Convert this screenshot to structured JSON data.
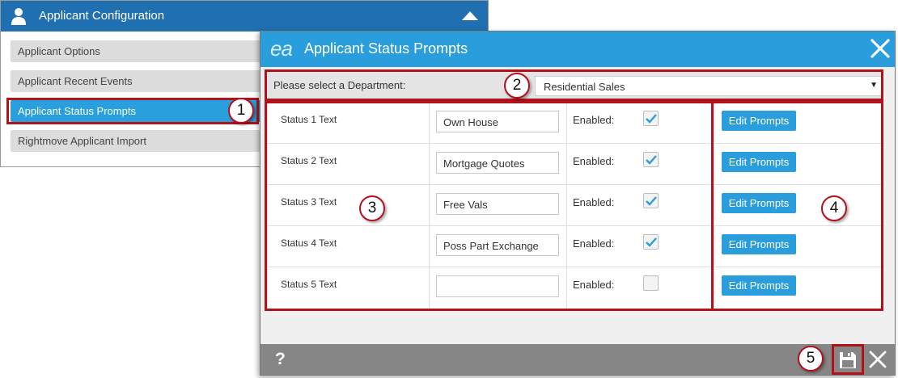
{
  "background_panel": {
    "title": "Applicant Configuration",
    "items": [
      {
        "label": "Applicant Options"
      },
      {
        "label": "Applicant Recent Events"
      },
      {
        "label": "Applicant Status Prompts"
      },
      {
        "label": "Rightmove Applicant Import"
      }
    ],
    "active_index": 2
  },
  "dialog": {
    "logo_text": "ea",
    "title": "Applicant Status Prompts",
    "department": {
      "label": "Please select a Department:",
      "selected": "Residential Sales"
    },
    "enabled_label": "Enabled:",
    "edit_button_label": "Edit Prompts",
    "rows": [
      {
        "label": "Status 1 Text",
        "value": "Own House",
        "enabled": true
      },
      {
        "label": "Status 2 Text",
        "value": "Mortgage Quotes",
        "enabled": true
      },
      {
        "label": "Status 3 Text",
        "value": "Free Vals",
        "enabled": true
      },
      {
        "label": "Status 4 Text",
        "value": "Poss Part Exchange",
        "enabled": true
      },
      {
        "label": "Status 5 Text",
        "value": "",
        "enabled": false
      }
    ],
    "footer": {
      "help_label": "?"
    }
  },
  "callouts": [
    "1",
    "2",
    "3",
    "4",
    "5"
  ],
  "colors": {
    "accent": "#2a9ddc",
    "header_dark": "#1f6fb1",
    "annotation": "#b4121b",
    "footer": "#868686"
  }
}
